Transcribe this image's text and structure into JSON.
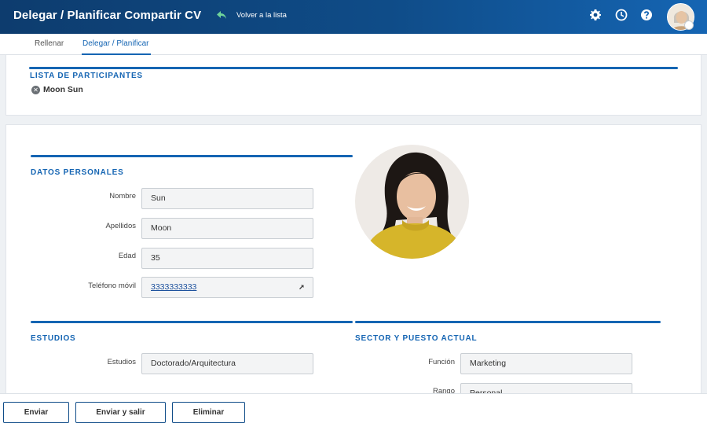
{
  "header": {
    "title": "Delegar / Planificar Compartir CV",
    "back_label": "Volver a la lista",
    "icons": [
      "gear-icon",
      "clock-icon",
      "help-icon",
      "avatar"
    ]
  },
  "tabs": [
    {
      "label": "Rellenar",
      "active": false
    },
    {
      "label": "Delegar / Planificar",
      "active": true
    }
  ],
  "participants": {
    "title": "LISTA DE PARTICIPANTES",
    "items": [
      "Moon Sun"
    ]
  },
  "personal": {
    "title": "DATOS PERSONALES",
    "fields": [
      {
        "label": "Nombre",
        "value": "Sun"
      },
      {
        "label": "Apellidos",
        "value": "Moon"
      },
      {
        "label": "Edad",
        "value": "35"
      },
      {
        "label": "Teléfono móvil",
        "value": "3333333333"
      }
    ]
  },
  "studies": {
    "title": "ESTUDIOS",
    "fields": [
      {
        "label": "Estudios",
        "value": "Doctorado/Arquitectura"
      }
    ]
  },
  "sector": {
    "title": "SECTOR Y PUESTO ACTUAL",
    "fields": [
      {
        "label": "Función",
        "value": "Marketing"
      },
      {
        "label": "Rango",
        "value": "Personal"
      }
    ]
  },
  "footer": {
    "buttons": [
      "Enviar",
      "Enviar y salir",
      "Eliminar"
    ]
  },
  "colors": {
    "accent": "#1565b3",
    "header_dark": "#0d3c6e",
    "photo_sweater": "#d6b52a"
  }
}
